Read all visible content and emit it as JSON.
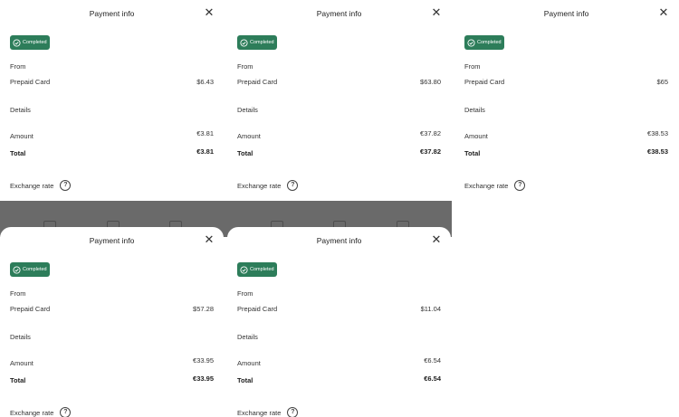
{
  "sheet_title": "Payment info",
  "status": "Completed",
  "from_label": "From",
  "details_label": "Details",
  "amount_label": "Amount",
  "total_label": "Total",
  "exchange_label": "Exchange rate",
  "colors": {
    "badge": "#2d7d5a",
    "backdrop": "#6a6a6a"
  },
  "icons": {
    "close": "close-icon",
    "status": "check-circle-icon",
    "help": "question-circle-icon"
  },
  "payments": [
    {
      "source": "Prepaid Card",
      "source_amount": "$6.43",
      "amount": "€3.81",
      "total": "€3.81"
    },
    {
      "source": "Prepaid Card",
      "source_amount": "$63.80",
      "amount": "€37.82",
      "total": "€37.82"
    },
    {
      "source": "Prepaid Card",
      "source_amount": "$65",
      "amount": "€38.53",
      "total": "€38.53"
    },
    {
      "source": "Prepaid Card",
      "source_amount": "$57.28",
      "amount": "€33.95",
      "total": "€33.95"
    },
    {
      "source": "Prepaid Card",
      "source_amount": "$11.04",
      "amount": "€6.54",
      "total": "€6.54"
    }
  ]
}
